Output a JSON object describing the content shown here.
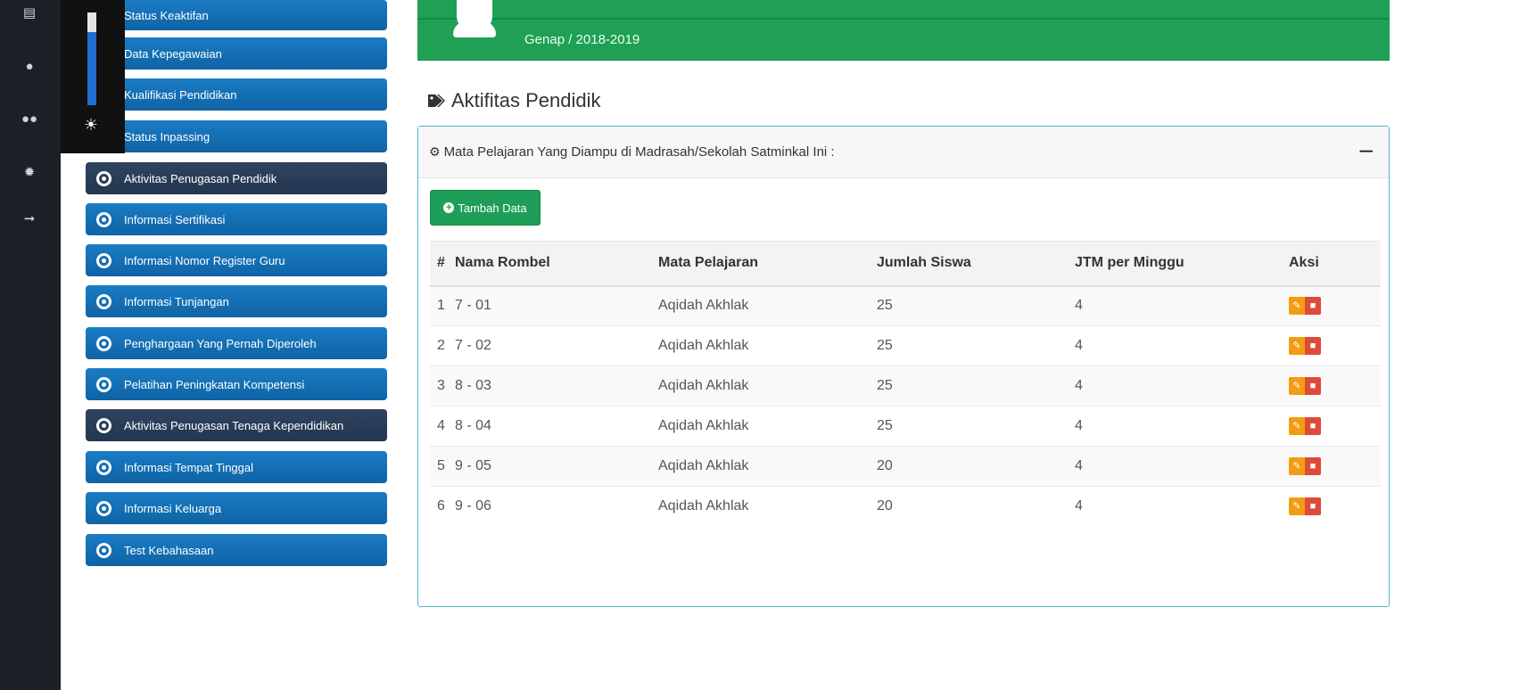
{
  "rail": {
    "icons": [
      "document-icon",
      "user-icon",
      "users-icon",
      "gear-icon",
      "sign-out-icon"
    ]
  },
  "sidebar": {
    "items": [
      {
        "label": "Status Keaktifan",
        "active": false
      },
      {
        "label": "Data Kepegawaian",
        "active": false
      },
      {
        "label": "Kualifikasi Pendidikan",
        "active": false
      },
      {
        "label": "Status Inpassing",
        "active": false
      },
      {
        "label": "Aktivitas Penugasan Pendidik",
        "active": true
      },
      {
        "label": "Informasi Sertifikasi",
        "active": false
      },
      {
        "label": "Informasi Nomor Register Guru",
        "active": false
      },
      {
        "label": "Informasi Tunjangan",
        "active": false
      },
      {
        "label": "Penghargaan Yang Pernah Diperoleh",
        "active": false
      },
      {
        "label": "Pelatihan Peningkatan Kompetensi",
        "active": false
      },
      {
        "label": "Aktivitas Penugasan Tenaga Kependidikan",
        "active": true
      },
      {
        "label": "Informasi Tempat Tinggal",
        "active": false
      },
      {
        "label": "Informasi Keluarga",
        "active": false
      },
      {
        "label": "Test Kebahasaan",
        "active": false
      }
    ]
  },
  "profile": {
    "semester": "Genap / 2018-2019"
  },
  "section": {
    "title": "Aktifitas Pendidik"
  },
  "box": {
    "header": "Mata Pelajaran Yang Diampu di Madrasah/Sekolah Satminkal Ini :",
    "add_button": "Tambah Data"
  },
  "table": {
    "headers": [
      "#",
      "Nama Rombel",
      "Mata Pelajaran",
      "Jumlah Siswa",
      "JTM per Minggu",
      "Aksi"
    ],
    "rows": [
      [
        "1",
        "7 - 01",
        "Aqidah Akhlak",
        "25",
        "4"
      ],
      [
        "2",
        "7 - 02",
        "Aqidah Akhlak",
        "25",
        "4"
      ],
      [
        "3",
        "8 - 03",
        "Aqidah Akhlak",
        "25",
        "4"
      ],
      [
        "4",
        "8 - 04",
        "Aqidah Akhlak",
        "25",
        "4"
      ],
      [
        "5",
        "9 - 05",
        "Aqidah Akhlak",
        "20",
        "4"
      ],
      [
        "6",
        "9 - 06",
        "Aqidah Akhlak",
        "20",
        "4"
      ]
    ]
  },
  "colors": {
    "green": "#1fa055",
    "blue": "#0f63a5",
    "navy": "#243650",
    "edit": "#f39c12",
    "delete": "#dd4b39"
  }
}
